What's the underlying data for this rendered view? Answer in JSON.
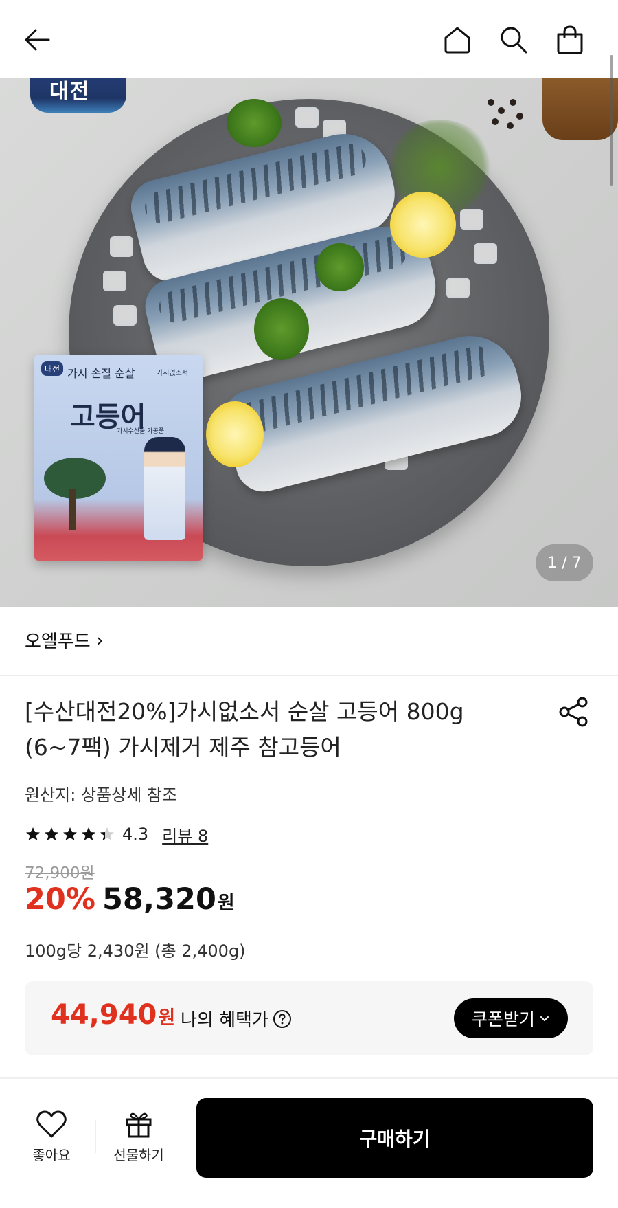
{
  "header": {
    "icons": [
      "back-arrow-icon",
      "home-icon",
      "search-icon",
      "shopping-bag-icon"
    ]
  },
  "hero": {
    "logo_text": "대전",
    "package": {
      "brand": "대전",
      "subtitle": "가시 손질 순살",
      "tag": "가시없소서",
      "title": "고등어",
      "small": "가시수산물 가공품"
    },
    "counter": "1 / 7"
  },
  "seller": {
    "name": "오엘푸드",
    "chevron": "›"
  },
  "product": {
    "title": "[수산대전20%]가시없소서 순살 고등어 800g (6~7팩) 가시제거 제주 참고등어",
    "origin": "원산지: 상품상세 참조",
    "rating": {
      "stars": 4.3,
      "value": "4.3",
      "review_label": "리뷰 8"
    },
    "original_price": "72,900원",
    "discount": "20%",
    "price": "58,320",
    "price_unit": "원",
    "unit_price": "100g당 2,430원 (총 2,400g)"
  },
  "benefit": {
    "price": "44,940",
    "price_unit": "원",
    "label": "나의 혜택가",
    "coupon_label": "쿠폰받기"
  },
  "bottom_bar": {
    "like_label": "좋아요",
    "gift_label": "선물하기",
    "buy_label": "구매하기"
  },
  "colors": {
    "accent_red": "#e0311f",
    "button_black": "#000000"
  }
}
